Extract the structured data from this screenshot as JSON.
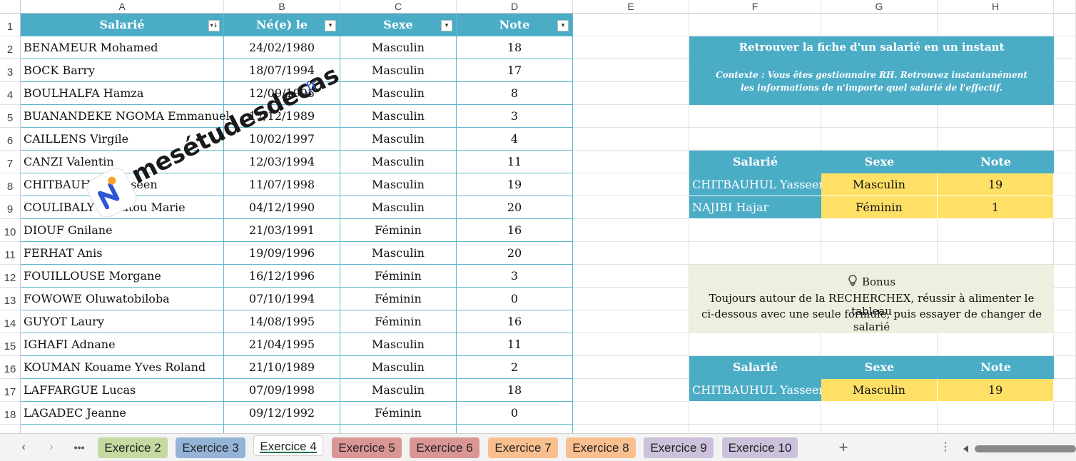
{
  "columns": [
    "A",
    "B",
    "C",
    "D",
    "E",
    "F",
    "G",
    "H"
  ],
  "rows": [
    "1",
    "2",
    "3",
    "4",
    "5",
    "6",
    "7",
    "8",
    "9",
    "10",
    "11",
    "12",
    "13",
    "14",
    "15",
    "16",
    "17",
    "18"
  ],
  "main_table": {
    "headers": [
      "Salarié",
      "Né(e) le",
      "Sexe",
      "Note"
    ],
    "rows": [
      [
        "BENAMEUR Mohamed",
        "24/02/1980",
        "Masculin",
        "18"
      ],
      [
        "BOCK Barry",
        "18/07/1994",
        "Masculin",
        "17"
      ],
      [
        "BOULHALFA Hamza",
        "12/09/1995",
        "Masculin",
        "8"
      ],
      [
        "BUANANDEKE NGOMA Emmanuel",
        "17/12/1989",
        "Masculin",
        "3"
      ],
      [
        "CAILLENS Virgile",
        "10/02/1997",
        "Masculin",
        "4"
      ],
      [
        "CANZI Valentin",
        "12/03/1994",
        "Masculin",
        "11"
      ],
      [
        "CHITBAUHUL Yasseen",
        "11/07/1998",
        "Masculin",
        "19"
      ],
      [
        "COULIBALY Aïssatou Marie",
        "04/12/1990",
        "Masculin",
        "20"
      ],
      [
        "DIOUF Gnilane",
        "21/03/1991",
        "Féminin",
        "16"
      ],
      [
        "FERHAT Anis",
        "19/09/1996",
        "Masculin",
        "20"
      ],
      [
        "FOUILLOUSE Morgane",
        "16/12/1996",
        "Féminin",
        "3"
      ],
      [
        "FOWOWE Oluwatobiloba",
        "07/10/1994",
        "Féminin",
        "0"
      ],
      [
        "GUYOT Laury",
        "14/08/1995",
        "Féminin",
        "16"
      ],
      [
        "IGHAFI Adnane",
        "21/04/1995",
        "Masculin",
        "11"
      ],
      [
        "KOUMAN Kouame Yves Roland",
        "21/10/1989",
        "Masculin",
        "2"
      ],
      [
        "LAFFARGUE Lucas",
        "07/09/1998",
        "Masculin",
        "18"
      ],
      [
        "LAGADEC Jeanne",
        "09/12/1992",
        "Féminin",
        "0"
      ]
    ]
  },
  "info_box": {
    "title": "Retrouver la fiche d'un salarié en un instant",
    "context": "Contexte : Vous êtes gestionnaire RH. Retrouvez instantanément les informations de n'importe quel salarié de l'effectif."
  },
  "lookup_table": {
    "headers": [
      "Salarié",
      "Sexe",
      "Note"
    ],
    "rows": [
      [
        "CHITBAUHUL Yasseen",
        "Masculin",
        "19"
      ],
      [
        "NAJIBI Hajar",
        "Féminin",
        "1"
      ]
    ]
  },
  "bonus": {
    "title": "Bonus",
    "line1": "Toujours autour de la RECHERCHEX, réussir à alimenter le tableau",
    "line2": "ci-dessous avec une seule formule, puis essayer de changer de salarié"
  },
  "bonus_table": {
    "headers": [
      "Salarié",
      "Sexe",
      "Note"
    ],
    "rows": [
      [
        "CHITBAUHUL Yasseen",
        "Masculin",
        "19"
      ]
    ]
  },
  "watermark": {
    "text": "mesétudesdecas",
    "suffix": ".fr"
  },
  "tabs": {
    "more": "•••",
    "add": "+",
    "options": "⋮",
    "items": [
      {
        "label": "Exercice 2",
        "color": "#c6d9a0"
      },
      {
        "label": "Exercice 3",
        "color": "#95b3d7"
      },
      {
        "label": "Exercice 4",
        "color": "#ffffff"
      },
      {
        "label": "Exercice 5",
        "color": "#da9694"
      },
      {
        "label": "Exercice 6",
        "color": "#da9694"
      },
      {
        "label": "Exercice 7",
        "color": "#fabf8f"
      },
      {
        "label": "Exercice 8",
        "color": "#fabf8f"
      },
      {
        "label": "Exercice 9",
        "color": "#ccc0da"
      },
      {
        "label": "Exercice 10",
        "color": "#ccc0da"
      }
    ],
    "active_index": 2
  },
  "colors": {
    "table_header": "#4bacc6",
    "highlight": "#ffe066",
    "bonus_bg": "#ebf1de",
    "active_tab_underline": "#1e7145"
  }
}
